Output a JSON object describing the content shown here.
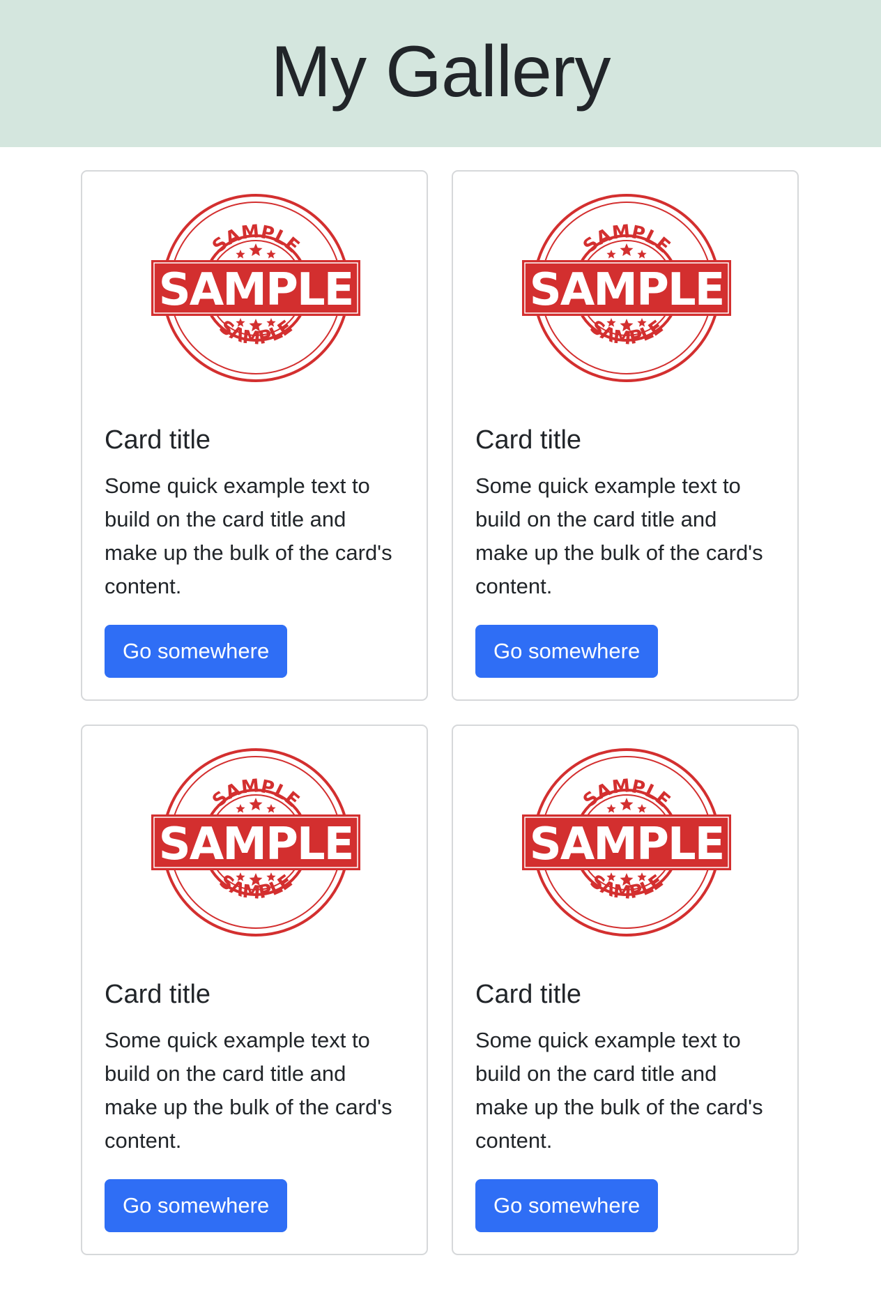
{
  "header": {
    "title": "My Gallery"
  },
  "colors": {
    "header_bg": "#d4e6de",
    "button_bg": "#2f6ef5",
    "stamp_red": "#d32f2f"
  },
  "cards": [
    {
      "image": {
        "stamp_text_main": "SAMPLE",
        "stamp_text_top": "SAMPLE",
        "stamp_text_bottom": "SAMPLE"
      },
      "title": "Card title",
      "text": "Some quick example text to build on the card title and make up the bulk of the card's content.",
      "button_label": "Go somewhere"
    },
    {
      "image": {
        "stamp_text_main": "SAMPLE",
        "stamp_text_top": "SAMPLE",
        "stamp_text_bottom": "SAMPLE"
      },
      "title": "Card title",
      "text": "Some quick example text to build on the card title and make up the bulk of the card's content.",
      "button_label": "Go somewhere"
    },
    {
      "image": {
        "stamp_text_main": "SAMPLE",
        "stamp_text_top": "SAMPLE",
        "stamp_text_bottom": "SAMPLE"
      },
      "title": "Card title",
      "text": "Some quick example text to build on the card title and make up the bulk of the card's content.",
      "button_label": "Go somewhere"
    },
    {
      "image": {
        "stamp_text_main": "SAMPLE",
        "stamp_text_top": "SAMPLE",
        "stamp_text_bottom": "SAMPLE"
      },
      "title": "Card title",
      "text": "Some quick example text to build on the card title and make up the bulk of the card's content.",
      "button_label": "Go somewhere"
    }
  ]
}
